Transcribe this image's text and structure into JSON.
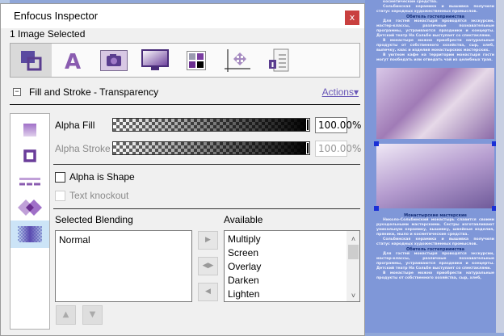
{
  "dialog": {
    "title": "Enfocus Inspector",
    "close_label": "x",
    "selection_info": "1 Image Selected"
  },
  "toolbar": {
    "items": [
      {
        "icon": "fill-stroke-icon",
        "active": true
      },
      {
        "icon": "text-icon"
      },
      {
        "icon": "camera-icon"
      },
      {
        "icon": "monitor-icon"
      },
      {
        "icon": "color-swatches-icon"
      },
      {
        "icon": "position-icon"
      },
      {
        "icon": "info-list-icon"
      }
    ]
  },
  "section": {
    "collapse_label": "−",
    "title": "Fill and Stroke - Transparency",
    "actions_label": "Actions▾"
  },
  "side_icons": [
    "fill-icon",
    "stroke-icon",
    "dash-icon",
    "overprint-icon",
    "transparency-icon"
  ],
  "transparency": {
    "alpha_fill_label": "Alpha Fill",
    "alpha_fill_value": "100.00",
    "alpha_fill_level": 100,
    "alpha_stroke_label": "Alpha Stroke",
    "alpha_stroke_value": "100.00",
    "alpha_stroke_level": 100,
    "percent": "%",
    "alpha_is_shape_label": "Alpha is Shape",
    "alpha_is_shape_checked": false,
    "text_knockout_label": "Text knockout",
    "text_knockout_checked": false
  },
  "blending": {
    "selected_label": "Selected Blending",
    "available_label": "Available",
    "selected": [
      "Normal"
    ],
    "available": [
      "Multiply",
      "Screen",
      "Overlay",
      "Darken",
      "Lighten"
    ]
  },
  "background_page": {
    "p1": "косметические средства.",
    "p2": "Сольбинская керамика и вышивка получили статус народных художественных промыслов.",
    "h1": "Обитель гостеприимства",
    "p3": "Для гостей монастыря проводятся экскурсии, мастер-классы, различные познавательные программы, устраиваются праздники и концерты. Детский театр На Сольбе выступает со спектаклями.",
    "p4": "В монастыре можно приобрести натуральные продукты от собственного хозяйства, сыр, хлеб, выпечку, квас и изделия монастырских мастерских.",
    "p5": "В уютном кафе на территории монастыря гости могут пообедать или отведать чай из целебных трав.",
    "h2": "Монастырские мастерские",
    "p6": "Николо-Сольбинский монастырь славится своими рукодельными мастерскими. Сестры изготавливают уникальную керамику, вышивку, швейные изделия, пряники, мыло и косметические средства.",
    "p7": "Сольбинская керамика и вышивка получили статус народных художественных промыслов.",
    "h3": "Обитель гостеприимства",
    "p8": "Для гостей монастыря проводятся экскурсии, мастер-классы, различные познавательные программы, устраиваются праздники и концерты. Детский театр На Сольбе выступает со спектаклями.",
    "p9": "В монастыре можно приобрести натуральные продукты от собственного хозяйства, сыр, хлеб,"
  },
  "colors": {
    "accent": "#6a3d9a",
    "close": "#c9403f",
    "link": "#6a58b8",
    "selected_row": "#cce4f7"
  }
}
